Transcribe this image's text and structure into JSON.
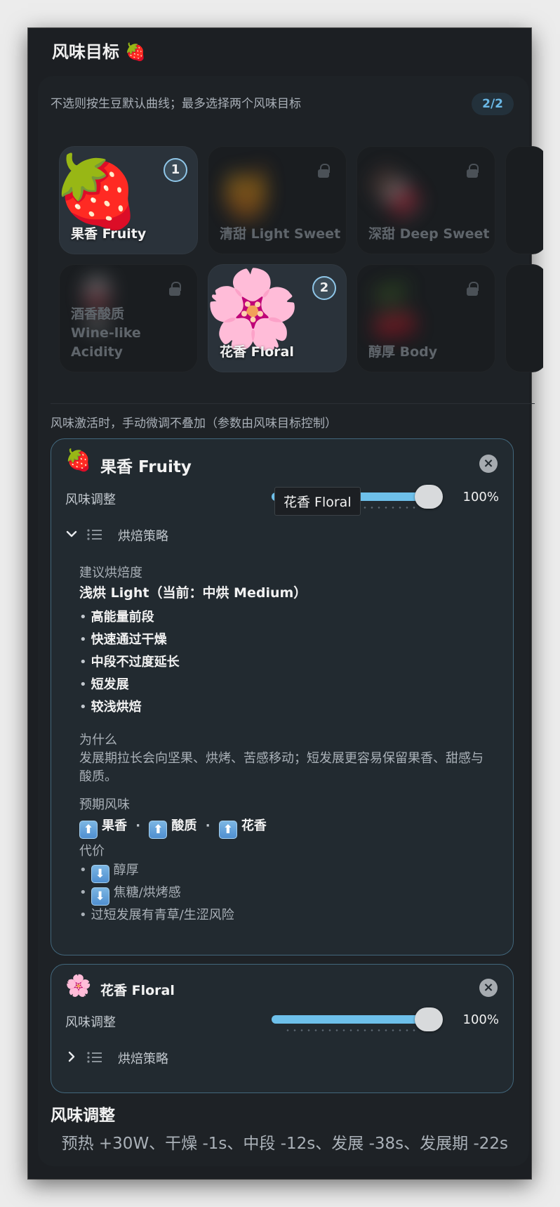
{
  "window": {
    "title": "风味目标",
    "title_emoji": "🍓"
  },
  "panel": {
    "hint": "不选则按生豆默认曲线；最多选择两个风味目标",
    "count_badge": "2/2"
  },
  "tiles": [
    {
      "label": "果香 Fruity",
      "emoji": "🍓",
      "selected": true,
      "order": "1"
    },
    {
      "label": "清甜 Light Sweet",
      "emoji": "🍯",
      "selected": false,
      "locked": true
    },
    {
      "label": "深甜 Deep Sweet",
      "emoji": "🍫",
      "selected": false,
      "locked": true
    },
    {
      "label_line1": "酒香酸质",
      "label_line2": "Wine-like Acidity",
      "emoji": "🍷",
      "selected": false,
      "locked": true
    },
    {
      "label": "花香 Floral",
      "emoji": "🌸",
      "selected": true,
      "order": "2"
    },
    {
      "label": "醇厚 Body",
      "emoji": "🍒",
      "selected": false,
      "locked": true
    }
  ],
  "note": "风味激活时，手动微调不叠加（参数由风味目标控制）",
  "tooltip": "花香 Floral",
  "card1": {
    "emoji": "🍓",
    "title": "果香 Fruity",
    "adjust_label": "风味调整",
    "adjust_value": 1.0,
    "adjust_pct": "100%",
    "strategy_label": "烘焙策略",
    "expanded": true,
    "roast_head": "建议烘焙度",
    "roast_value": "浅烘 Light（当前：中烘 Medium）",
    "bullets": [
      "高能量前段",
      "快速通过干燥",
      "中段不过度延长",
      "短发展",
      "较浅烘焙"
    ],
    "why_head": "为什么",
    "why_text": "发展期拉长会向坚果、烘烤、苦感移动；短发展更容易保留果香、甜感与酸质。",
    "expect_head": "预期风味",
    "expect": [
      "果香",
      "酸质",
      "花香"
    ],
    "cost_head": "代价",
    "costs": [
      {
        "icon": "down-arrow",
        "text": "醇厚"
      },
      {
        "icon": "down-arrow",
        "text": "焦糖/烘烤感"
      },
      {
        "icon": "",
        "text": "过短发展有青草/生涩风险"
      }
    ]
  },
  "card2": {
    "emoji": "🌸",
    "title": "花香 Floral",
    "adjust_label": "风味调整",
    "adjust_value": 1.0,
    "adjust_pct": "100%",
    "strategy_label": "烘焙策略",
    "expanded": false
  },
  "bottom": {
    "title": "风味调整",
    "text": "预热 +30W、干燥 -1s、中段 -12s、发展 -38s、发展期 -22s"
  },
  "colors": {
    "accent": "#6ec0ea",
    "card_border": "#42677c",
    "background": "#1c1f23"
  }
}
